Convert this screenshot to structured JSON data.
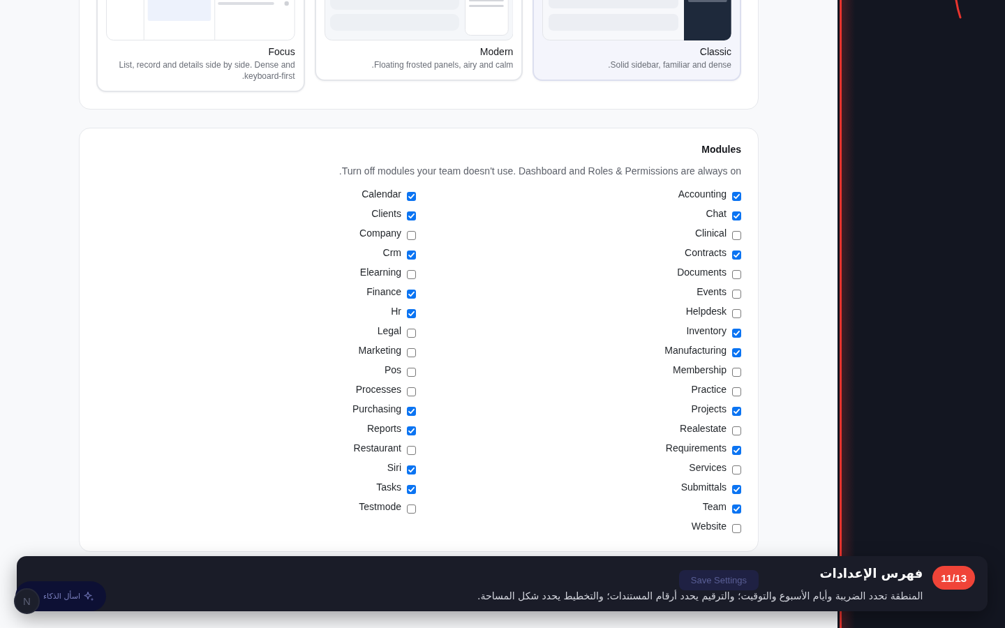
{
  "layouts": [
    {
      "kind": "focus",
      "title": "Focus",
      "description": "List, record and details side by side. Dense and .keyboard-first",
      "selected": false
    },
    {
      "kind": "modern",
      "title": "Modern",
      "description": ".Floating frosted panels, airy and calm",
      "selected": false
    },
    {
      "kind": "classic",
      "title": "Classic",
      "description": ".Solid sidebar, familiar and dense",
      "selected": true
    }
  ],
  "modules": {
    "title": "Modules",
    "description": ".Turn off modules your team doesn't use. Dashboard and Roles & Permissions are always on",
    "columns": [
      {
        "items": [
          {
            "label": "Calendar",
            "checked": true
          },
          {
            "label": "Clients",
            "checked": true
          },
          {
            "label": "Company",
            "checked": false
          },
          {
            "label": "Crm",
            "checked": true
          },
          {
            "label": "Elearning",
            "checked": false
          },
          {
            "label": "Finance",
            "checked": true
          },
          {
            "label": "Hr",
            "checked": true
          },
          {
            "label": "Legal",
            "checked": false
          },
          {
            "label": "Marketing",
            "checked": false
          },
          {
            "label": "Pos",
            "checked": false
          },
          {
            "label": "Processes",
            "checked": false
          },
          {
            "label": "Purchasing",
            "checked": true
          },
          {
            "label": "Reports",
            "checked": true
          },
          {
            "label": "Restaurant",
            "checked": false
          },
          {
            "label": "Siri",
            "checked": true
          },
          {
            "label": "Tasks",
            "checked": true
          },
          {
            "label": "Testmode",
            "checked": false
          }
        ]
      },
      {
        "items": [
          {
            "label": "Accounting",
            "checked": true
          },
          {
            "label": "Chat",
            "checked": true
          },
          {
            "label": "Clinical",
            "checked": false
          },
          {
            "label": "Contracts",
            "checked": true
          },
          {
            "label": "Documents",
            "checked": false
          },
          {
            "label": "Events",
            "checked": false
          },
          {
            "label": "Helpdesk",
            "checked": false
          },
          {
            "label": "Inventory",
            "checked": true
          },
          {
            "label": "Manufacturing",
            "checked": true
          },
          {
            "label": "Membership",
            "checked": false
          },
          {
            "label": "Practice",
            "checked": false
          },
          {
            "label": "Projects",
            "checked": true
          },
          {
            "label": "Realestate",
            "checked": false
          },
          {
            "label": "Requirements",
            "checked": true
          },
          {
            "label": "Services",
            "checked": false
          },
          {
            "label": "Submittals",
            "checked": true
          },
          {
            "label": "Team",
            "checked": true
          },
          {
            "label": "Website",
            "checked": false
          }
        ]
      }
    ]
  },
  "save_button": {
    "label": "Save Settings"
  },
  "assistant": {
    "label": "اسأل الذكاء",
    "avatar": "N"
  },
  "tour": {
    "step": "11/13",
    "title": "فهرس الإعدادات",
    "description": "المنطقة تحدد الضريبة وأيام الأسبوع والتوقيت؛ والترقيم يحدد أرقام المستندات؛ والتخطيط يحدد شكل المساحة."
  }
}
